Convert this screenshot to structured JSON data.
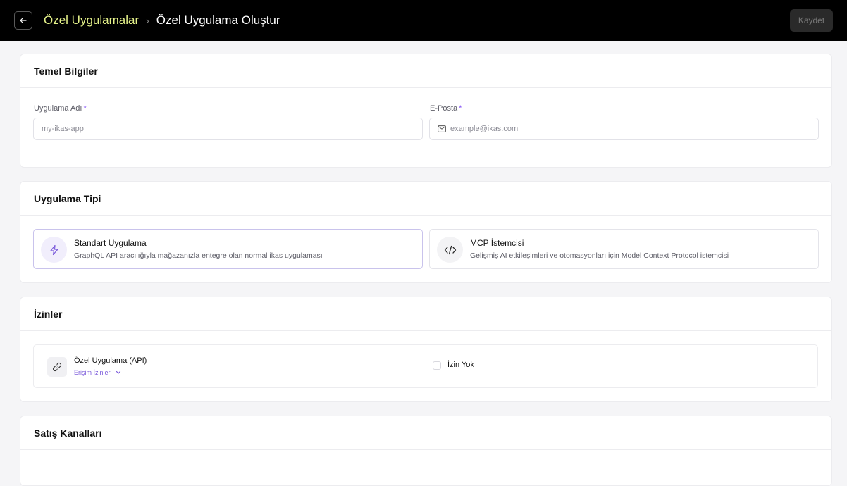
{
  "header": {
    "breadcrumb_parent": "Özel Uygulamalar",
    "breadcrumb_separator": "›",
    "breadcrumb_current": "Özel Uygulama Oluştur",
    "save_label": "Kaydet"
  },
  "basic_info": {
    "title": "Temel Bilgiler",
    "app_name": {
      "label": "Uygulama Adı",
      "required_mark": "*",
      "placeholder": "my-ikas-app"
    },
    "email": {
      "label": "E-Posta",
      "required_mark": "*",
      "placeholder": "example@ikas.com"
    }
  },
  "app_type": {
    "title": "Uygulama Tipi",
    "options": [
      {
        "title": "Standart Uygulama",
        "description": "GraphQL API aracılığıyla mağazanızla entegre olan normal ikas uygulaması",
        "icon": "lightning-icon",
        "selected": true
      },
      {
        "title": "MCP İstemcisi",
        "description": "Gelişmiş AI etkileşimleri ve otomasyonları için Model Context Protocol istemcisi",
        "icon": "code-icon",
        "selected": false
      }
    ]
  },
  "permissions": {
    "title": "İzinler",
    "item": {
      "title": "Özel Uygulama (API)",
      "access_label": "Erişim İzinleri",
      "icon": "link-icon"
    },
    "no_permission_label": "İzin Yok"
  },
  "sales_channels": {
    "title": "Satış Kanalları"
  },
  "colors": {
    "topbar": "#000000",
    "breadcrumb_link": "#e5f28a",
    "accent": "#7c5cdb"
  }
}
